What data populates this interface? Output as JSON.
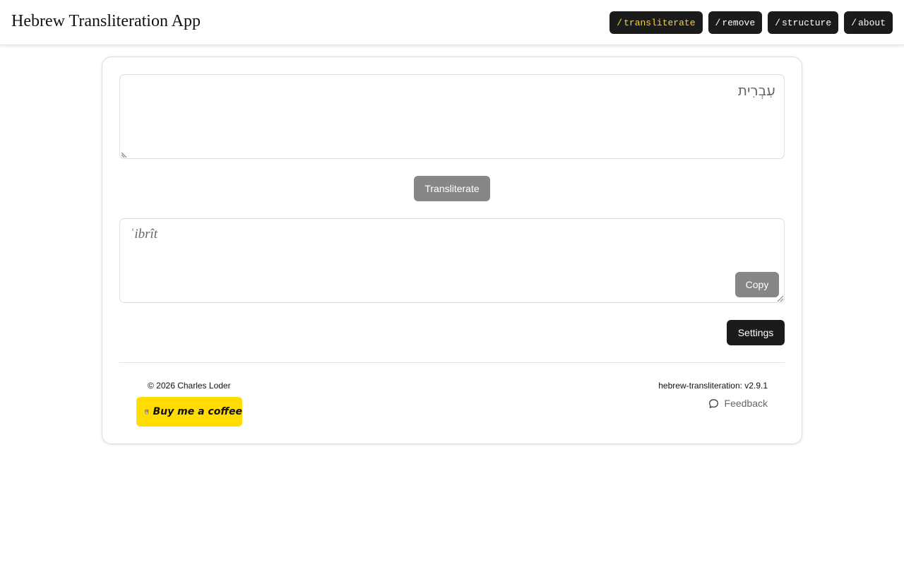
{
  "header": {
    "title": "Hebrew Transliteration App",
    "nav": [
      {
        "slash": "/",
        "label": "transliterate",
        "active": true
      },
      {
        "slash": "/",
        "label": "remove",
        "active": false
      },
      {
        "slash": "/",
        "label": "structure",
        "active": false
      },
      {
        "slash": "/",
        "label": "about",
        "active": false
      }
    ]
  },
  "main": {
    "input_value": "עִבְרִית",
    "transliterate_label": "Transliterate",
    "output_value": "ʿibrît",
    "copy_label": "Copy",
    "settings_label": "Settings"
  },
  "footer": {
    "copyright": "© 2026 Charles Loder",
    "coffee_label": "Buy me a coffee",
    "version": "hebrew-transliteration: v2.9.1",
    "feedback_label": "Feedback"
  },
  "colors": {
    "accent_active": "#f5d33d",
    "dark_button": "#1b1b1b",
    "muted_button": "#878787",
    "coffee_yellow": "#ffdd00"
  },
  "icons": {
    "coffee": "coffee-cup-icon",
    "feedback": "chat-bubble-icon"
  }
}
